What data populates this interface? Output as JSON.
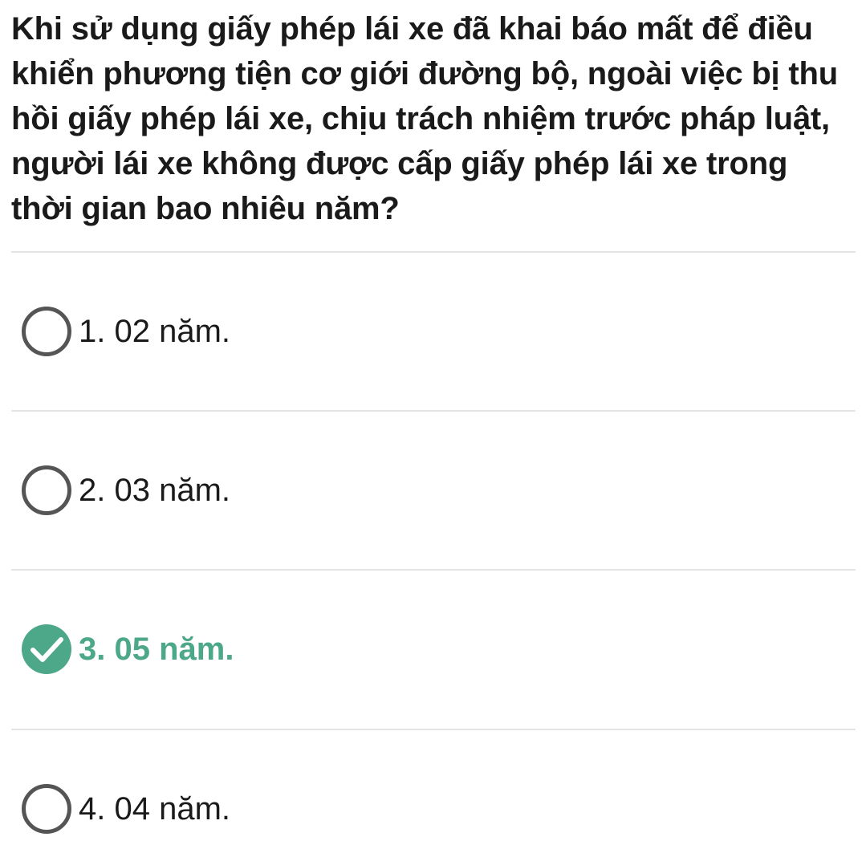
{
  "question": {
    "text": "Khi sử dụng giấy phép lái xe đã khai báo mất để điều khiển phương tiện cơ giới đường bộ, ngoài việc bị thu hồi giấy phép lái xe, chịu trách nhiệm trước pháp luật, người lái xe không được cấp giấy phép lái xe trong thời gian bao nhiêu năm?"
  },
  "options": [
    {
      "label": "1. 02 năm.",
      "selected": false
    },
    {
      "label": "2. 03 năm.",
      "selected": false
    },
    {
      "label": "3. 05 năm.",
      "selected": true
    },
    {
      "label": "4. 04 năm.",
      "selected": false
    }
  ],
  "colors": {
    "text": "#1a1a1a",
    "selected_accent": "#4da88a",
    "radio_outline": "#555555",
    "divider": "#e4e4e4"
  },
  "icons": {
    "unselected": "radio-empty-icon",
    "selected": "check-circle-icon"
  }
}
